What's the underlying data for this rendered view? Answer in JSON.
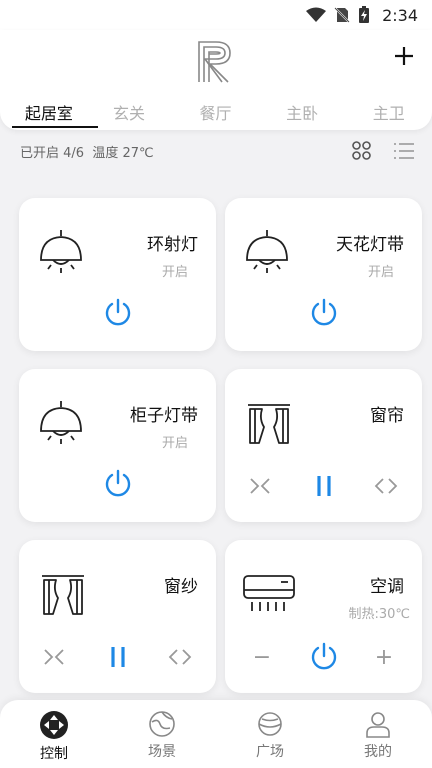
{
  "status_bar": {
    "time": "2:34"
  },
  "header": {
    "logo": "R",
    "add_icon": "plus-icon",
    "tabs": [
      {
        "label": "起居室",
        "active": true
      },
      {
        "label": "玄关",
        "active": false
      },
      {
        "label": "餐厅",
        "active": false
      },
      {
        "label": "主卧",
        "active": false
      },
      {
        "label": "主卫",
        "active": false
      }
    ]
  },
  "summary": {
    "text": "已开启 4/6  温度 27℃"
  },
  "devices": [
    {
      "name": "环射灯",
      "status": "开启",
      "icon": "pendant-lamp-icon"
    },
    {
      "name": "天花灯带",
      "status": "开启",
      "icon": "pendant-lamp-icon"
    },
    {
      "name": "柜子灯带",
      "status": "开启",
      "icon": "pendant-lamp-icon"
    },
    {
      "name": "窗帘",
      "status": "",
      "icon": "curtain-icon"
    },
    {
      "name": "窗纱",
      "status": "",
      "icon": "curtain-icon"
    },
    {
      "name": "空调",
      "status": "制热:30℃",
      "icon": "air-conditioner-icon"
    }
  ],
  "ac_controls": {
    "minus": "−",
    "plus": "+"
  },
  "bottom_nav": [
    {
      "label": "控制",
      "icon": "control-icon",
      "active": true
    },
    {
      "label": "场景",
      "icon": "scene-icon",
      "active": false
    },
    {
      "label": "广场",
      "icon": "planet-icon",
      "active": false
    },
    {
      "label": "我的",
      "icon": "user-icon",
      "active": false
    }
  ],
  "colors": {
    "accent": "#1e88e5",
    "text": "#111111",
    "muted": "#aaaaaa",
    "background": "#f2f2f4"
  }
}
